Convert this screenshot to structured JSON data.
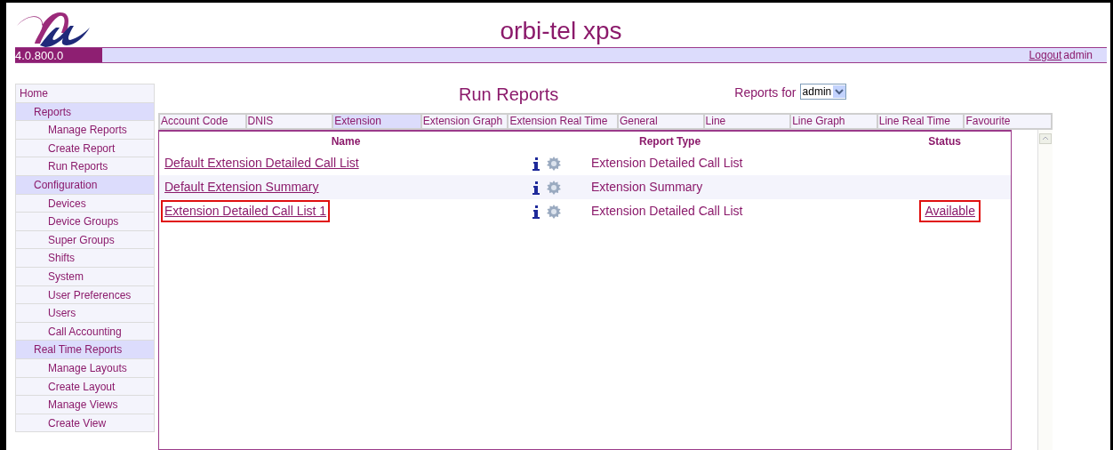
{
  "header": {
    "title": "orbi-tel xps",
    "version": "4.0.800.0",
    "logout": "Logout",
    "user": "admin"
  },
  "sidebar": {
    "items": [
      {
        "label": "Home"
      },
      {
        "label": "Reports",
        "children": [
          {
            "label": "Manage Reports"
          },
          {
            "label": "Create Report"
          },
          {
            "label": "Run Reports"
          }
        ]
      },
      {
        "label": "Configuration",
        "children": [
          {
            "label": "Devices"
          },
          {
            "label": "Device Groups"
          },
          {
            "label": "Super Groups"
          },
          {
            "label": "Shifts"
          },
          {
            "label": "System"
          },
          {
            "label": "User Preferences"
          },
          {
            "label": "Users"
          },
          {
            "label": "Call Accounting"
          }
        ]
      },
      {
        "label": "Real Time Reports",
        "children": [
          {
            "label": "Manage Layouts"
          },
          {
            "label": "Create Layout"
          },
          {
            "label": "Manage Views"
          },
          {
            "label": "Create View"
          }
        ]
      }
    ]
  },
  "page_title": "Run Reports",
  "reports_for": {
    "label": "Reports for",
    "value": "admin"
  },
  "tabs": [
    {
      "label": "Account Code",
      "selected": false
    },
    {
      "label": "DNIS",
      "selected": false
    },
    {
      "label": "Extension",
      "selected": true
    },
    {
      "label": "Extension Graph",
      "selected": false
    },
    {
      "label": "Extension Real Time",
      "selected": false
    },
    {
      "label": "General",
      "selected": false
    },
    {
      "label": "Line",
      "selected": false
    },
    {
      "label": "Line Graph",
      "selected": false
    },
    {
      "label": "Line Real Time",
      "selected": false
    },
    {
      "label": "Favourite",
      "selected": false
    }
  ],
  "table": {
    "columns": [
      "Name",
      "Report Type",
      "Status"
    ],
    "rows": [
      {
        "name": "Default Extension Detailed Call List",
        "report_type": "Extension Detailed Call List",
        "highlighted": false
      },
      {
        "name": "Default Extension Summary",
        "report_type": "Extension Summary",
        "highlighted": false
      },
      {
        "name": "Extension Detailed Call List 1",
        "report_type": "Extension Detailed Call List",
        "status": "Available",
        "highlighted": true
      }
    ]
  }
}
